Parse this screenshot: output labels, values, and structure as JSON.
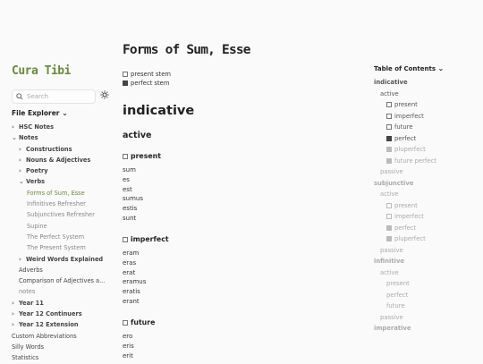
{
  "sidebar": {
    "title": "Cura Tibi",
    "search_placeholder": "Search",
    "file_explorer_label": "File Explorer",
    "items": [
      {
        "label": "HSC Notes",
        "chev": "›",
        "indent": 0,
        "style": "b"
      },
      {
        "label": "Notes",
        "chev": "⌄",
        "indent": 0,
        "style": "b"
      },
      {
        "label": "Constructions",
        "chev": "›",
        "indent": 1,
        "style": "b"
      },
      {
        "label": "Nouns & Adjectives",
        "chev": "›",
        "indent": 1,
        "style": "b"
      },
      {
        "label": "Poetry",
        "chev": "›",
        "indent": 1,
        "style": "b"
      },
      {
        "label": "Verbs",
        "chev": "⌄",
        "indent": 1,
        "style": "b"
      },
      {
        "label": "Forms of Sum, Esse",
        "chev": "",
        "indent": 2,
        "style": "act"
      },
      {
        "label": "Infinitives Refresher",
        "chev": "",
        "indent": 2,
        "style": "l"
      },
      {
        "label": "Subjunctives Refresher",
        "chev": "",
        "indent": 2,
        "style": "l"
      },
      {
        "label": "Supine",
        "chev": "",
        "indent": 2,
        "style": "l"
      },
      {
        "label": "The Perfect System",
        "chev": "",
        "indent": 2,
        "style": "l"
      },
      {
        "label": "The Present System",
        "chev": "",
        "indent": 2,
        "style": "l"
      },
      {
        "label": "Weird Words Explained",
        "chev": "›",
        "indent": 1,
        "style": "b"
      },
      {
        "label": "Adverbs",
        "chev": "",
        "indent": 1,
        "style": "n"
      },
      {
        "label": "Comparison of Adjectives a...",
        "chev": "",
        "indent": 1,
        "style": "n"
      },
      {
        "label": "notes",
        "chev": "",
        "indent": 1,
        "style": "l"
      },
      {
        "label": "Year 11",
        "chev": "›",
        "indent": 0,
        "style": "b"
      },
      {
        "label": "Year 12 Continuers",
        "chev": "›",
        "indent": 0,
        "style": "b"
      },
      {
        "label": "Year 12 Extension",
        "chev": "›",
        "indent": 0,
        "style": "b"
      },
      {
        "label": "Custom Abbreviations",
        "chev": "",
        "indent": -1,
        "style": "n"
      },
      {
        "label": "Silly Words",
        "chev": "",
        "indent": -1,
        "style": "n"
      },
      {
        "label": "Statistics",
        "chev": "",
        "indent": -1,
        "style": "n"
      }
    ]
  },
  "page": {
    "title": "Forms of Sum, Esse",
    "legend": [
      "present stem",
      "perfect stem"
    ],
    "section": "indicative",
    "voice": "active",
    "tenses": [
      {
        "label": "present",
        "words": [
          "sum",
          "es",
          "est",
          "sumus",
          "estis",
          "sunt"
        ]
      },
      {
        "label": "imperfect",
        "words": [
          "eram",
          "eras",
          "erat",
          "eramus",
          "eratis",
          "erant"
        ]
      },
      {
        "label": "future",
        "words": [
          "ero",
          "eris",
          "erit"
        ]
      }
    ]
  },
  "toc": {
    "title": "Table of Contents",
    "items": [
      {
        "label": "indicative",
        "indent": 0,
        "style": "d b",
        "box": ""
      },
      {
        "label": "active",
        "indent": 1,
        "style": "d",
        "box": ""
      },
      {
        "label": "present",
        "indent": 2,
        "style": "d",
        "box": "box"
      },
      {
        "label": "imperfect",
        "indent": 2,
        "style": "d",
        "box": "box"
      },
      {
        "label": "future",
        "indent": 2,
        "style": "d",
        "box": "box"
      },
      {
        "label": "perfect",
        "indent": 2,
        "style": "d",
        "box": "box filled"
      },
      {
        "label": "pluperfect",
        "indent": 2,
        "style": "f",
        "box": "box faintf"
      },
      {
        "label": "future perfect",
        "indent": 2,
        "style": "f",
        "box": "box faintf"
      },
      {
        "label": "passive",
        "indent": 1,
        "style": "f",
        "box": ""
      },
      {
        "label": "subjunctive",
        "indent": 0,
        "style": "f b",
        "box": ""
      },
      {
        "label": "active",
        "indent": 1,
        "style": "f",
        "box": ""
      },
      {
        "label": "present",
        "indent": 2,
        "style": "f",
        "box": "box faint"
      },
      {
        "label": "imperfect",
        "indent": 2,
        "style": "f",
        "box": "box faint"
      },
      {
        "label": "perfect",
        "indent": 2,
        "style": "f",
        "box": "box faintf"
      },
      {
        "label": "pluperfect",
        "indent": 2,
        "style": "f",
        "box": "box faintf"
      },
      {
        "label": "passive",
        "indent": 1,
        "style": "f",
        "box": ""
      },
      {
        "label": "infinitive",
        "indent": 0,
        "style": "f b",
        "box": ""
      },
      {
        "label": "active",
        "indent": 1,
        "style": "f",
        "box": ""
      },
      {
        "label": "present",
        "indent": 2,
        "style": "f",
        "box": ""
      },
      {
        "label": "perfect",
        "indent": 2,
        "style": "f",
        "box": ""
      },
      {
        "label": "future",
        "indent": 2,
        "style": "f",
        "box": ""
      },
      {
        "label": "passive",
        "indent": 1,
        "style": "f",
        "box": ""
      },
      {
        "label": "imperative",
        "indent": 0,
        "style": "f b",
        "box": ""
      }
    ]
  }
}
